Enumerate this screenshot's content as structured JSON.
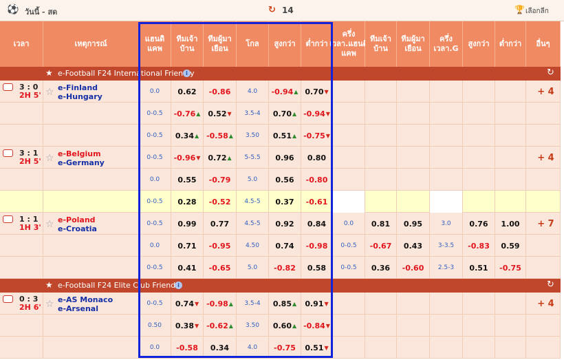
{
  "topbar": {
    "title": "วันนี้ - สด",
    "refresh_count": "14",
    "league_select": "เลือกลีก"
  },
  "headers": {
    "time": "เวลา",
    "event": "เหตุการณ์",
    "hdp": "แฮนดิแคพ",
    "home": "ทีมเจ้าบ้าน",
    "away": "ทีมผู้มาเยือน",
    "goal": "โกล",
    "over": "สูงกว่า",
    "under": "ต่ำกว่า",
    "ht_hdp": "ครึ่งเวลา.แฮนดิแคพ",
    "ht_home": "ทีมเจ้าบ้าน",
    "ht_away": "ทีมผู้มาเยือน",
    "ht_goal": "ครึ่งเวลา.G",
    "ht_over": "สูงกว่า",
    "ht_under": "ต่ำกว่า",
    "more": "อื่นๆ"
  },
  "leagues": [
    {
      "name": "e-Football F24 International Friendly"
    },
    {
      "name": "e-Football F24 Elite Club Friendly"
    }
  ],
  "rows": [
    {
      "score": "3 : 0",
      "time": "2H 5'",
      "team1": "e-Finland",
      "team2": "e-Hungary",
      "t1fav": true,
      "hdp": "0.0",
      "home": "0.62",
      "away": "-0.86",
      "goal": "4.0",
      "over": "-0.94",
      "under": "0.70",
      "more": "+ 4"
    },
    {
      "hdp": "0-0.5",
      "home": "-0.76",
      "away": "0.52",
      "goal": "3.5-4",
      "over": "0.70",
      "under": "-0.94"
    },
    {
      "hdp": "0-0.5",
      "home": "0.34",
      "away": "-0.58",
      "goal": "3.50",
      "over": "0.51",
      "under": "-0.75"
    },
    {
      "score": "3 : 1",
      "time": "2H 5'",
      "team1": "e-Belgium",
      "team2": "e-Germany",
      "hdp": "0-0.5",
      "home": "-0.96",
      "away": "0.72",
      "goal": "5-5.5",
      "over": "0.96",
      "under": "0.80",
      "more": "+ 4"
    },
    {
      "hdp": "0.0",
      "home": "0.55",
      "away": "-0.79",
      "goal": "5.0",
      "over": "0.56",
      "under": "-0.80"
    },
    {
      "hdp": "0-0.5",
      "home": "0.28",
      "away": "-0.52",
      "goal": "4.5-5",
      "over": "0.37",
      "under": "-0.61"
    },
    {
      "score": "1 : 1",
      "time": "1H 3'",
      "team1": "e-Poland",
      "team2": "e-Croatia",
      "hdp": "0-0.5",
      "home": "0.99",
      "away": "0.77",
      "goal": "4.5-5",
      "over": "0.92",
      "under": "0.84",
      "ht_hdp": "0.0",
      "ht_home": "0.81",
      "ht_away": "0.95",
      "ht_goal": "3.0",
      "ht_over": "0.76",
      "ht_under": "1.00",
      "more": "+ 7"
    },
    {
      "hdp": "0.0",
      "home": "0.71",
      "away": "-0.95",
      "goal": "4.50",
      "over": "0.74",
      "under": "-0.98",
      "ht_hdp": "0-0.5",
      "ht_home": "-0.67",
      "ht_away": "0.43",
      "ht_goal": "3-3.5",
      "ht_over": "-0.83",
      "ht_under": "0.59"
    },
    {
      "hdp": "0-0.5",
      "home": "0.41",
      "away": "-0.65",
      "goal": "5.0",
      "over": "-0.82",
      "under": "0.58",
      "ht_hdp": "0-0.5",
      "ht_home": "0.36",
      "ht_away": "-0.60",
      "ht_goal": "2.5-3",
      "ht_over": "0.51",
      "ht_under": "-0.75"
    },
    {
      "score": "0 : 3",
      "time": "2H 6'",
      "team1": "e-AS Monaco",
      "team2": "e-Arsenal",
      "t1fav": true,
      "hdp": "0-0.5",
      "home": "0.74",
      "away": "-0.98",
      "goal": "3.5-4",
      "over": "0.85",
      "under": "0.91",
      "more": "+ 4"
    },
    {
      "hdp": "0.50",
      "home": "0.38",
      "away": "-0.62",
      "goal": "3.50",
      "over": "0.60",
      "under": "-0.84"
    },
    {
      "hdp": "0.0",
      "home": "-0.58",
      "away": "0.34",
      "goal": "4.0",
      "over": "-0.75",
      "under": "0.51"
    }
  ],
  "colors": {
    "header": "#f08a62",
    "league_bar": "#c0472b",
    "row_bg": "#fbe6db",
    "row_alt": "#fbf0e8",
    "highlight": "#ffffcc",
    "highlight_box": "#1122dd"
  }
}
